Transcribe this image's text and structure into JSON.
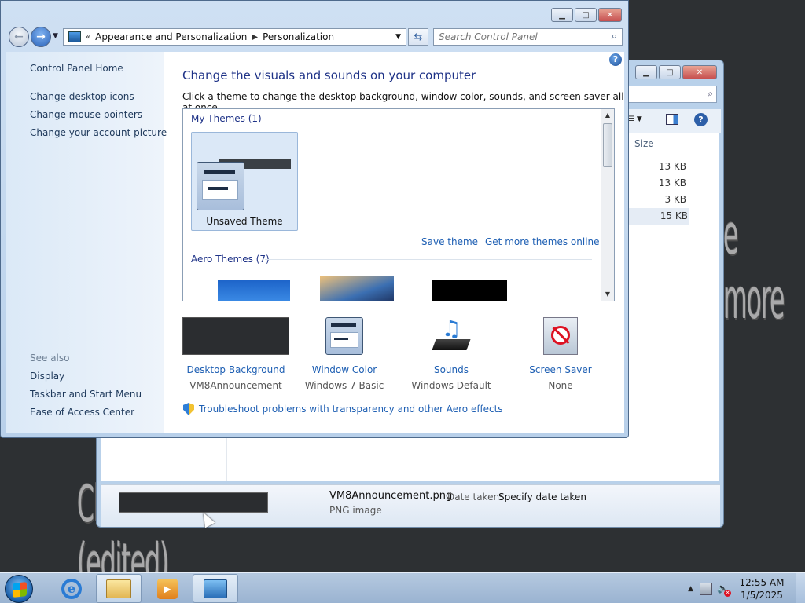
{
  "wallpaper": {
    "text_left": "Check it out! (edited)",
    "text_right": "e more"
  },
  "explorer": {
    "column_size": "Size",
    "sizes": [
      "13 KB",
      "13 KB",
      "3 KB",
      "15 KB"
    ],
    "details": {
      "filename": "VM8Announcement.png",
      "type": "PNG image",
      "date_label": "Date taken:",
      "date_value": "Specify date taken"
    }
  },
  "window": {
    "breadcrumb": [
      "Appearance and Personalization",
      "Personalization"
    ],
    "search_placeholder": "Search Control Panel"
  },
  "sidebar": {
    "home": "Control Panel Home",
    "links": [
      "Change desktop icons",
      "Change mouse pointers",
      "Change your account picture"
    ],
    "see_also_label": "See also",
    "see_also": [
      "Display",
      "Taskbar and Start Menu",
      "Ease of Access Center"
    ]
  },
  "main": {
    "heading": "Change the visuals and sounds on your computer",
    "subheading": "Click a theme to change the desktop background, window color, sounds, and screen saver all at once.",
    "my_themes_label": "My Themes (1)",
    "unsaved_theme": "Unsaved Theme",
    "save_theme": "Save theme",
    "get_more": "Get more themes online",
    "aero_themes_label": "Aero Themes (7)",
    "options": [
      {
        "name": "Desktop Background",
        "value": "VM8Announcement"
      },
      {
        "name": "Window Color",
        "value": "Windows 7 Basic"
      },
      {
        "name": "Sounds",
        "value": "Windows Default"
      },
      {
        "name": "Screen Saver",
        "value": "None"
      }
    ],
    "troubleshoot": "Troubleshoot problems with transparency and other Aero effects"
  },
  "taskbar": {
    "time": "12:55 AM",
    "date": "1/5/2025"
  }
}
